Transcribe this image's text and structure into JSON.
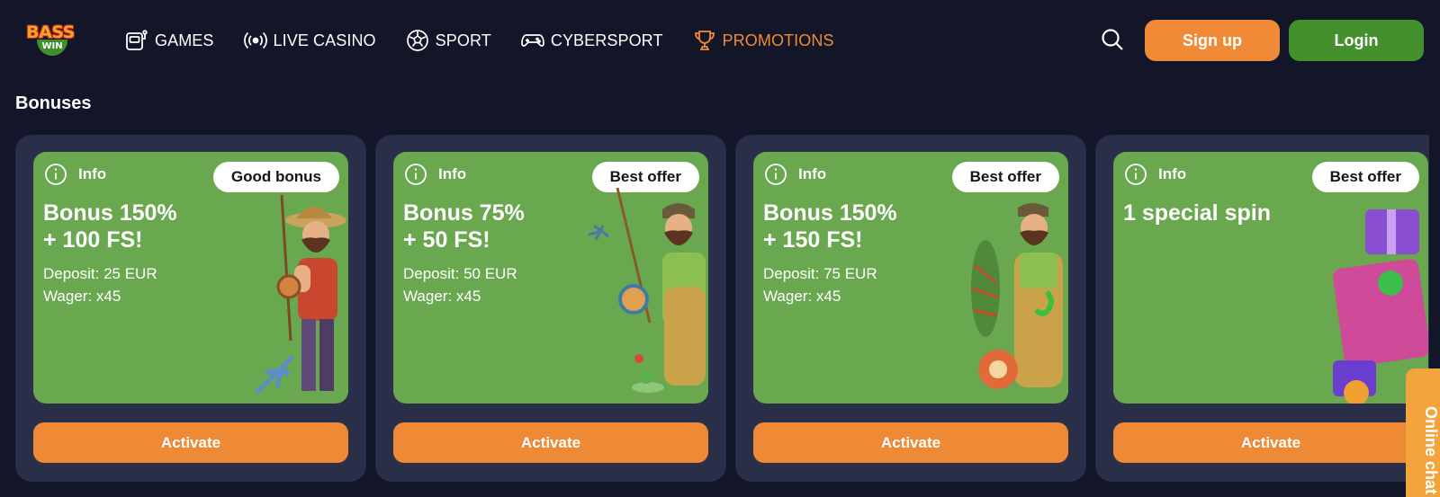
{
  "logo": {
    "line1": "BASS",
    "line2": "WIN"
  },
  "nav": [
    {
      "label": "GAMES",
      "icon": "slot-machine-icon",
      "active": false
    },
    {
      "label": "LIVE CASINO",
      "icon": "broadcast-icon",
      "active": false
    },
    {
      "label": "SPORT",
      "icon": "soccer-ball-icon",
      "active": false
    },
    {
      "label": "CYBERSPORT",
      "icon": "gamepad-icon",
      "active": true
    },
    {
      "label": "PROMOTIONS",
      "icon": "trophy-icon",
      "active": true
    }
  ],
  "header": {
    "signup_label": "Sign up",
    "login_label": "Login",
    "search_icon": "search-icon"
  },
  "section": {
    "title": "Bonuses"
  },
  "cards": [
    {
      "info": "Info",
      "badge": "Good bonus",
      "title_line1": "Bonus 150%",
      "title_line2": "+ 100 FS!",
      "deposit": "Deposit: 25 EUR",
      "wager": "Wager: x45",
      "button": "Activate"
    },
    {
      "info": "Info",
      "badge": "Best offer",
      "title_line1": "Bonus 75%",
      "title_line2": "+ 50 FS!",
      "deposit": "Deposit: 50 EUR",
      "wager": "Wager: x45",
      "button": "Activate"
    },
    {
      "info": "Info",
      "badge": "Best offer",
      "title_line1": "Bonus 150%",
      "title_line2": "+ 150 FS!",
      "deposit": "Deposit: 75 EUR",
      "wager": "Wager: x45",
      "button": "Activate"
    },
    {
      "info": "Info",
      "badge": "Best offer",
      "title_line1": "1 special spin",
      "title_line2": "",
      "deposit": "",
      "wager": "",
      "button": "Activate"
    }
  ],
  "chat": {
    "label": "Online chat"
  },
  "colors": {
    "background": "#121628",
    "card": "#2a2f49",
    "promo": "#6aa84f",
    "accent": "#f08a36",
    "login": "#43902d"
  }
}
